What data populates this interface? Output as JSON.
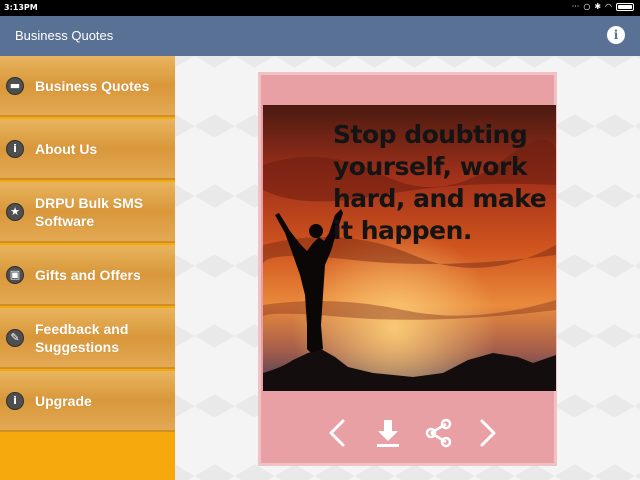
{
  "status": {
    "time": "3:13PM"
  },
  "app": {
    "title": "Business Quotes"
  },
  "sidebar": {
    "items": [
      {
        "label": "Business Quotes",
        "icon": "briefcase-icon"
      },
      {
        "label": "About Us",
        "icon": "info-icon"
      },
      {
        "label": "DRPU Bulk SMS Software",
        "icon": "star-icon"
      },
      {
        "label": "Gifts and Offers",
        "icon": "gift-icon"
      },
      {
        "label": "Feedback and Suggestions",
        "icon": "feedback-icon"
      },
      {
        "label": "Upgrade",
        "icon": "info-icon"
      }
    ]
  },
  "quote": {
    "text": "Stop doubting yourself, work hard, and make it happen."
  },
  "colors": {
    "app_bar": "#5a7196",
    "sidebar": "#f5a90d",
    "card": "#e9a0a5"
  }
}
